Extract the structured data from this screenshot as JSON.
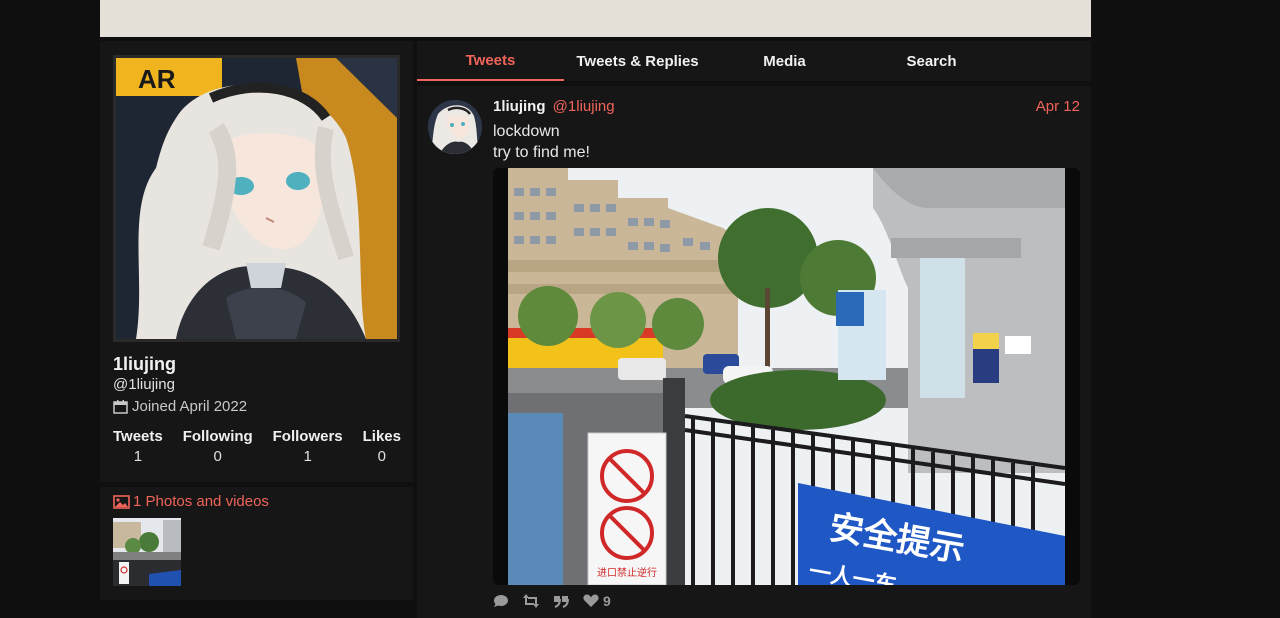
{
  "profile": {
    "name": "1liujing",
    "handle": "@1liujing",
    "joined": "Joined April 2022",
    "avatar_badge": "AR",
    "stats": [
      {
        "label": "Tweets",
        "value": "1"
      },
      {
        "label": "Following",
        "value": "0"
      },
      {
        "label": "Followers",
        "value": "1"
      },
      {
        "label": "Likes",
        "value": "0"
      }
    ]
  },
  "media": {
    "title": "1 Photos and videos"
  },
  "tabs": [
    {
      "label": "Tweets",
      "active": true
    },
    {
      "label": "Tweets & Replies",
      "active": false
    },
    {
      "label": "Media",
      "active": false
    },
    {
      "label": "Search",
      "active": false
    }
  ],
  "tweet": {
    "name": "1liujing",
    "handle": "@1liujing",
    "date": "Apr 12",
    "line1": "lockdown",
    "line2": "try to find me!",
    "likes": "9",
    "photo_signs": {
      "gate_sign": "进口禁止逆行",
      "pillar": "进口禁止逆行",
      "blue_sign": "安全提示",
      "blue_sign_sub": "一人一车"
    }
  },
  "colors": {
    "accent": "#f0645a",
    "background": "#0f0f0f",
    "panel": "#161616"
  },
  "icons": [
    "calendar-icon",
    "image-icon",
    "reply-icon",
    "retweet-icon",
    "quote-icon",
    "heart-icon"
  ]
}
